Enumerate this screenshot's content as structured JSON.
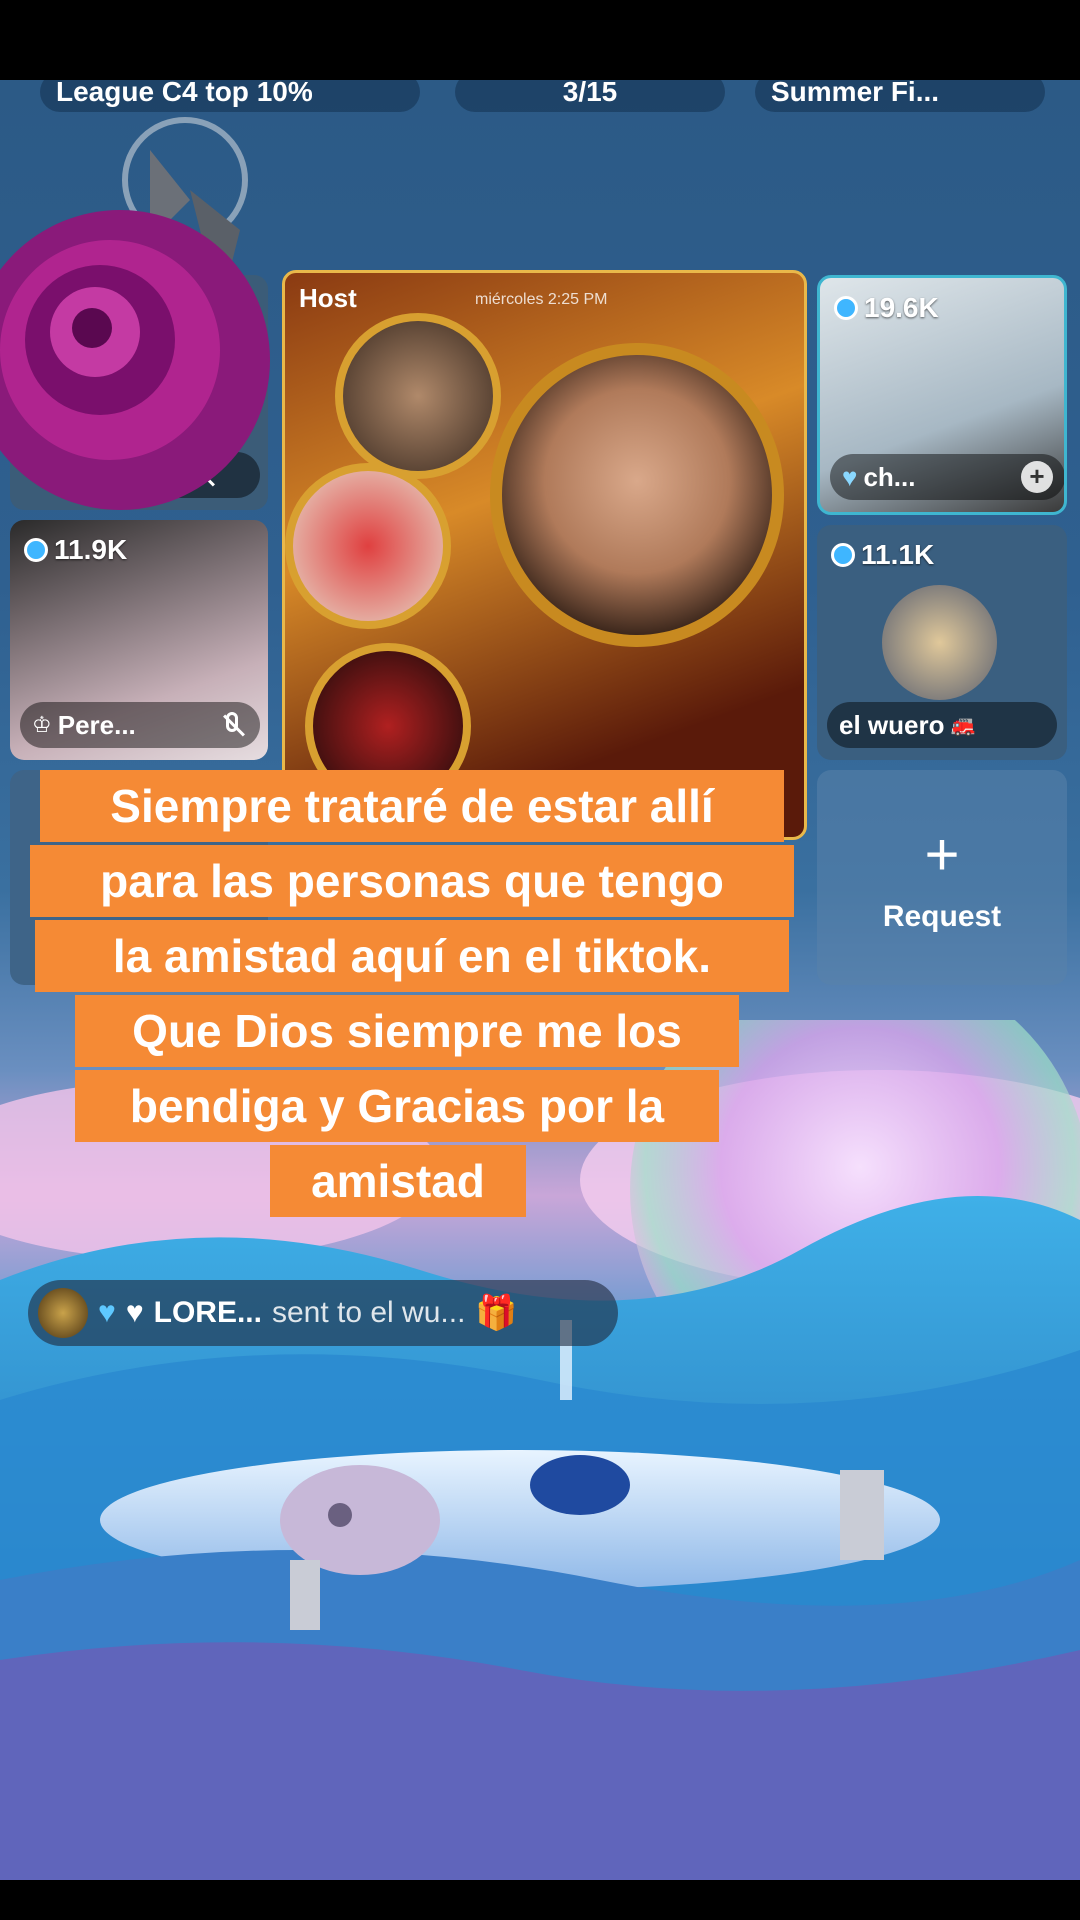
{
  "top_pills": {
    "league": "League C4 top 10%",
    "rank": "3/15",
    "event": "Summer Fi..."
  },
  "host_tile": {
    "host_label": "Host",
    "date_text": "miércoles 2:25 PM"
  },
  "tiles": [
    {
      "id": "top-left",
      "name": "...",
      "has_plus": true,
      "muted": true
    },
    {
      "id": "mid-left",
      "score": "11.9K",
      "name": "Pere...",
      "muted": true
    },
    {
      "id": "top-right",
      "score": "19.6K",
      "name": "ch...",
      "has_plus": true
    },
    {
      "id": "mid-right",
      "score": "11.1K",
      "name": "el wuero"
    },
    {
      "id": "request",
      "label": "Request"
    }
  ],
  "caption": [
    "Siempre trataré de estar allí",
    "para las personas que tengo",
    "la amistad aquí en el tiktok.",
    "Que Dios siempre me los",
    "bendiga y Gracias por la",
    "amistad"
  ],
  "gift": {
    "sender": "LORE...",
    "text": "sent to el wu..."
  },
  "colors": {
    "caption_bg": "#f58a35",
    "coin": "#3fb6ff"
  }
}
